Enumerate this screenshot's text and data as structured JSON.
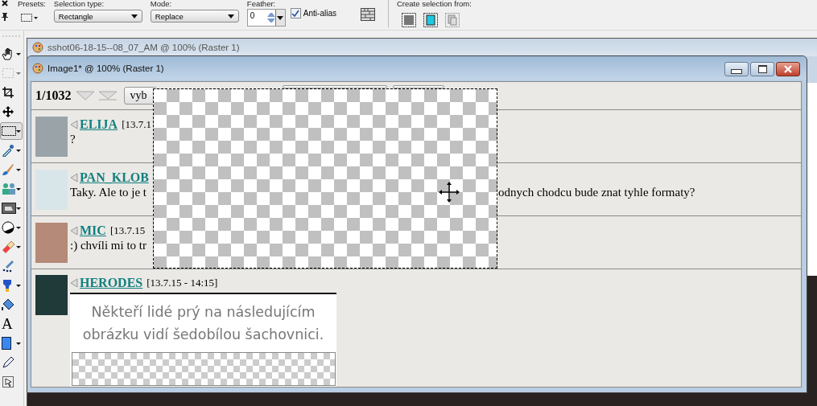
{
  "toolbar": {
    "presets_label": "Presets:",
    "selection_type": {
      "label": "Selection type:",
      "value": "Rectangle"
    },
    "mode": {
      "label": "Mode:",
      "value": "Replace"
    },
    "feather": {
      "label": "Feather:",
      "value": "0"
    },
    "anti_alias": {
      "label": "Anti-alias",
      "checked": true
    },
    "create_selection_label": "Create selection from:"
  },
  "tools": [
    {
      "kind": "hand",
      "selected": false,
      "disabled": false,
      "dropdown": true
    },
    {
      "kind": "marquee",
      "selected": false,
      "disabled": true,
      "dropdown": true
    },
    {
      "kind": "crop",
      "selected": false,
      "disabled": false,
      "dropdown": false
    },
    {
      "kind": "move",
      "selected": false,
      "disabled": false,
      "dropdown": false
    },
    {
      "kind": "selection",
      "selected": true,
      "disabled": false,
      "dropdown": true
    },
    {
      "kind": "dropper",
      "selected": false,
      "disabled": false,
      "dropdown": true
    },
    {
      "kind": "brush",
      "selected": false,
      "disabled": false,
      "dropdown": true
    },
    {
      "kind": "clone",
      "selected": false,
      "disabled": false,
      "dropdown": true
    },
    {
      "kind": "image",
      "selected": false,
      "disabled": false,
      "dropdown": true
    },
    {
      "kind": "contrast",
      "selected": false,
      "disabled": false,
      "dropdown": true
    },
    {
      "kind": "eraser",
      "selected": false,
      "disabled": false,
      "dropdown": true
    },
    {
      "kind": "smudge",
      "selected": false,
      "disabled": false,
      "dropdown": false
    },
    {
      "kind": "tube",
      "selected": false,
      "disabled": false,
      "dropdown": true
    },
    {
      "kind": "bucket",
      "selected": false,
      "disabled": false,
      "dropdown": false
    },
    {
      "kind": "text",
      "label": "A",
      "selected": false,
      "disabled": false,
      "dropdown": false
    },
    {
      "kind": "rectangle",
      "selected": false,
      "disabled": false,
      "dropdown": true
    },
    {
      "kind": "pen",
      "selected": false,
      "disabled": false,
      "dropdown": false
    },
    {
      "kind": "pick",
      "selected": false,
      "disabled": false,
      "dropdown": false
    }
  ],
  "back_window": {
    "title": "sshot06-18-15--08_07_AM @ 100% (Raster 1)"
  },
  "image_window": {
    "title": "Image1* @ 100% (Raster 1)"
  },
  "page": {
    "counter": "1/1032",
    "button": "vyb",
    "posts": [
      {
        "name": "ELIJA",
        "date": "[13.7.1",
        "text": "?"
      },
      {
        "name": "PAN_KLOB",
        "text": "Taky. Ale to je t",
        "text_right": "odnych chodcu bude znat tyhle formaty?"
      },
      {
        "name": "MIC",
        "date": "[13.7.15",
        "text": ":) chvíli mi to tr"
      },
      {
        "name": "HERODES",
        "date": "[13.7.15 - 14:15]",
        "image_caption": "Někteří lidé prý na následujícím obrázku vidí šedobílou šachovnici."
      }
    ]
  }
}
